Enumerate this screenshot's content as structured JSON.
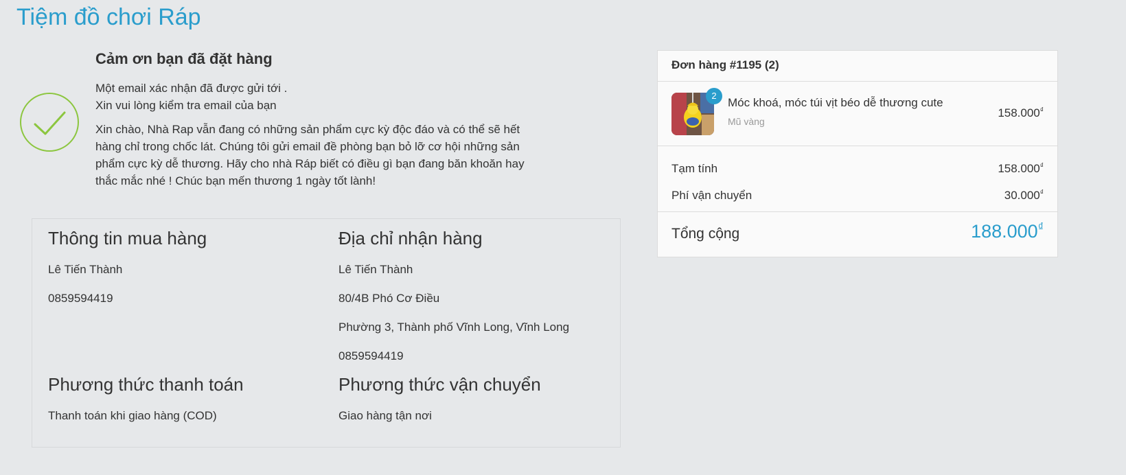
{
  "shop": {
    "title": "Tiệm đồ chơi Ráp"
  },
  "thanks": {
    "heading": "Cảm ơn bạn đã đặt hàng",
    "email_line1": "Một email xác nhận đã được gửi tới .",
    "email_line2": "Xin vui lòng kiểm tra email của bạn",
    "greeting": "Xin chào, Nhà Rap vẫn đang có những sản phẩm cực kỳ độc đáo và có thể sẽ hết hàng chỉ trong chốc lát. Chúng tôi gửi email đề phòng bạn bỏ lỡ cơ hội những sản phẩm cực kỳ dễ thương. Hãy cho nhà Ráp biết có điều gì bạn đang băn khoăn hay thắc mắc nhé ! Chúc bạn mến thương 1 ngày tốt lành!"
  },
  "buyer_info": {
    "heading": "Thông tin mua hàng",
    "name": "Lê Tiến Thành",
    "phone": "0859594419"
  },
  "shipping_address": {
    "heading": "Địa chỉ nhận hàng",
    "name": "Lê Tiến Thành",
    "street": "80/4B Phó Cơ Điều",
    "ward_city": "Phường 3, Thành phố Vĩnh Long, Vĩnh Long",
    "phone": "0859594419"
  },
  "payment_method": {
    "heading": "Phương thức thanh toán",
    "value": "Thanh toán khi giao hàng (COD)"
  },
  "shipping_method": {
    "heading": "Phương thức vận chuyển",
    "value": "Giao hàng tận nơi"
  },
  "order": {
    "header": "Đơn hàng #1195 (2)",
    "currency_symbol": "₫",
    "item": {
      "name": "Móc khoá, móc túi vịt béo dễ thương cute",
      "variant": "Mũ vàng",
      "quantity": "2",
      "price": "158.000",
      "thumb_icon": "duck-keychain-image"
    },
    "subtotal_label": "Tạm tính",
    "subtotal_value": "158.000",
    "shipping_label": "Phí vận chuyển",
    "shipping_value": "30.000",
    "total_label": "Tổng cộng",
    "total_value": "188.000"
  },
  "colors": {
    "accent": "#2a9dcc",
    "success": "#8cc63f",
    "background": "#e6e8ea"
  }
}
